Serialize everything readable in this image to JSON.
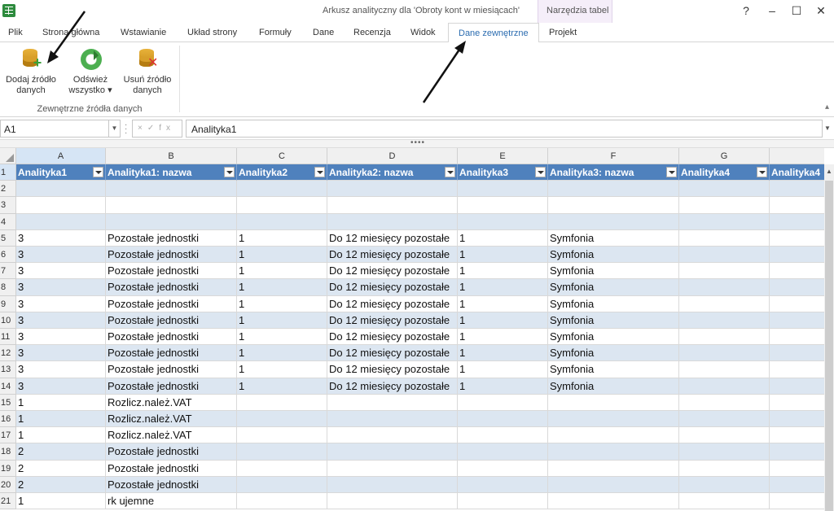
{
  "window": {
    "title": "Arkusz analityczny dla 'Obroty kont w miesiącach'",
    "context_header": "Narzędzia tabel",
    "controls": [
      "?",
      "–",
      "☐",
      "✕"
    ]
  },
  "tabs": [
    {
      "label": "Plik"
    },
    {
      "label": "Strona główna"
    },
    {
      "label": "Wstawianie"
    },
    {
      "label": "Układ strony"
    },
    {
      "label": "Formuły"
    },
    {
      "label": "Dane"
    },
    {
      "label": "Recenzja"
    },
    {
      "label": "Widok"
    },
    {
      "label": "Dane zewnętrzne",
      "active": true
    },
    {
      "label": "Projekt"
    }
  ],
  "ribbon": {
    "buttons": [
      {
        "line1": "Dodaj źródło",
        "line2": "danych",
        "icon": "add-datasource-icon"
      },
      {
        "line1": "Odśwież",
        "line2": "wszystko ▾",
        "icon": "refresh-icon"
      },
      {
        "line1": "Usuń źródło",
        "line2": "danych",
        "icon": "remove-datasource-icon"
      }
    ],
    "group_label": "Zewnętrzne źródła danych"
  },
  "formula_bar": {
    "name_box": "A1",
    "formula": "Analityka1"
  },
  "columns": [
    "A",
    "B",
    "C",
    "D",
    "E",
    "F",
    "G",
    ""
  ],
  "header_row": [
    "Analityka1",
    "Analityka1: nazwa",
    "Analityka2",
    "Analityka2: nazwa",
    "Analityka3",
    "Analityka3: nazwa",
    "Analityka4",
    "Analityka4"
  ],
  "rows": [
    {
      "n": "2",
      "cells": [
        "",
        "",
        "",
        "",
        "",
        "",
        "",
        ""
      ]
    },
    {
      "n": "3",
      "cells": [
        "",
        "",
        "",
        "",
        "",
        "",
        "",
        ""
      ]
    },
    {
      "n": "4",
      "cells": [
        "",
        "",
        "",
        "",
        "",
        "",
        "",
        ""
      ]
    },
    {
      "n": "5",
      "cells": [
        "3",
        "Pozostałe jednostki",
        "1",
        "Do 12 miesięcy pozostałe",
        "1",
        "Symfonia",
        "",
        ""
      ]
    },
    {
      "n": "6",
      "cells": [
        "3",
        "Pozostałe jednostki",
        "1",
        "Do 12 miesięcy pozostałe",
        "1",
        "Symfonia",
        "",
        ""
      ]
    },
    {
      "n": "7",
      "cells": [
        "3",
        "Pozostałe jednostki",
        "1",
        "Do 12 miesięcy pozostałe",
        "1",
        "Symfonia",
        "",
        ""
      ]
    },
    {
      "n": "8",
      "cells": [
        "3",
        "Pozostałe jednostki",
        "1",
        "Do 12 miesięcy pozostałe",
        "1",
        "Symfonia",
        "",
        ""
      ]
    },
    {
      "n": "9",
      "cells": [
        "3",
        "Pozostałe jednostki",
        "1",
        "Do 12 miesięcy pozostałe",
        "1",
        "Symfonia",
        "",
        ""
      ]
    },
    {
      "n": "10",
      "cells": [
        "3",
        "Pozostałe jednostki",
        "1",
        "Do 12 miesięcy pozostałe",
        "1",
        "Symfonia",
        "",
        ""
      ]
    },
    {
      "n": "11",
      "cells": [
        "3",
        "Pozostałe jednostki",
        "1",
        "Do 12 miesięcy pozostałe",
        "1",
        "Symfonia",
        "",
        ""
      ]
    },
    {
      "n": "12",
      "cells": [
        "3",
        "Pozostałe jednostki",
        "1",
        "Do 12 miesięcy pozostałe",
        "1",
        "Symfonia",
        "",
        ""
      ]
    },
    {
      "n": "13",
      "cells": [
        "3",
        "Pozostałe jednostki",
        "1",
        "Do 12 miesięcy pozostałe",
        "1",
        "Symfonia",
        "",
        ""
      ]
    },
    {
      "n": "14",
      "cells": [
        "3",
        "Pozostałe jednostki",
        "1",
        "Do 12 miesięcy pozostałe",
        "1",
        "Symfonia",
        "",
        ""
      ]
    },
    {
      "n": "15",
      "cells": [
        "1",
        "Rozlicz.należ.VAT",
        "",
        "",
        "",
        "",
        "",
        ""
      ]
    },
    {
      "n": "16",
      "cells": [
        "1",
        "Rozlicz.należ.VAT",
        "",
        "",
        "",
        "",
        "",
        ""
      ]
    },
    {
      "n": "17",
      "cells": [
        "1",
        "Rozlicz.należ.VAT",
        "",
        "",
        "",
        "",
        "",
        ""
      ]
    },
    {
      "n": "18",
      "cells": [
        "2",
        "Pozostałe jednostki",
        "",
        "",
        "",
        "",
        "",
        ""
      ]
    },
    {
      "n": "19",
      "cells": [
        "2",
        "Pozostałe jednostki",
        "",
        "",
        "",
        "",
        "",
        ""
      ]
    },
    {
      "n": "20",
      "cells": [
        "2",
        "Pozostałe jednostki",
        "",
        "",
        "",
        "",
        "",
        ""
      ]
    },
    {
      "n": "21",
      "cells": [
        "1",
        "rk ujemne",
        "",
        "",
        "",
        "",
        "",
        ""
      ]
    }
  ],
  "colors": {
    "table_header": "#4f81bd",
    "band": "#dce6f1",
    "active_tab_text": "#2b6cb0"
  }
}
